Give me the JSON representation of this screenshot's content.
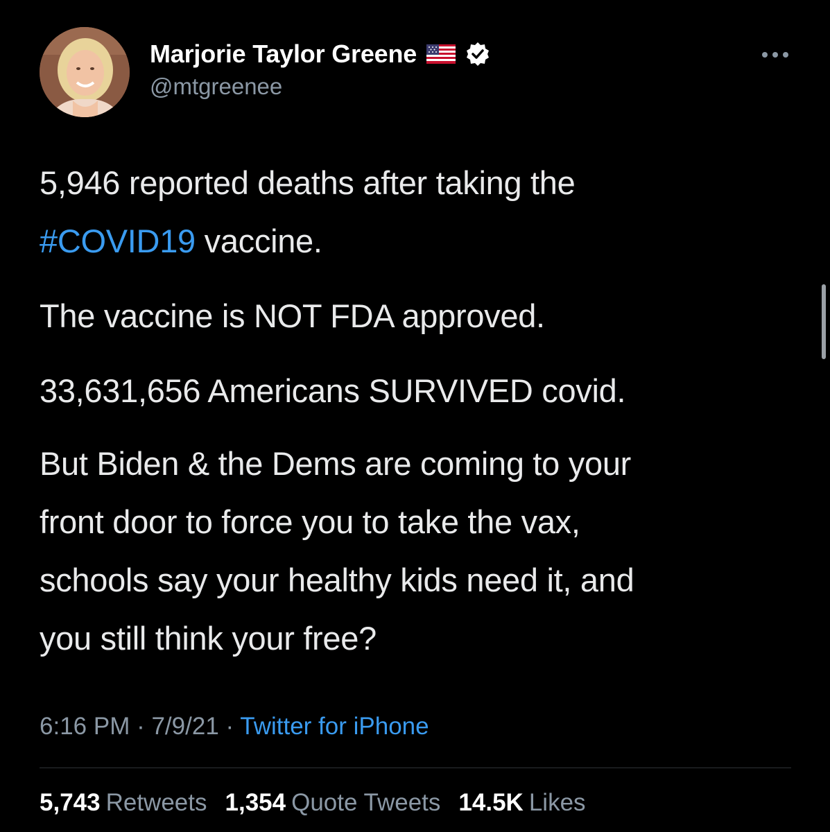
{
  "tweet": {
    "display_name": "Marjorie Taylor Greene",
    "handle": "@mtgreenee",
    "flag_icon": "us-flag-emoji",
    "verified_icon": "verified-badge",
    "more_icon": "ellipsis-horizontal",
    "paragraphs": {
      "p1_line1": "5,946 reported deaths after taking the",
      "p1_hashtag": "#COVID19",
      "p1_line2_rest": " vaccine.",
      "p2": "The vaccine is NOT FDA approved.",
      "p3": "33,631,656 Americans SURVIVED covid.",
      "p4_line1": "But Biden & the Dems are coming to your",
      "p4_line2": "front door to force you to take the vax,",
      "p4_line3": "schools say your healthy kids need it, and",
      "p4_line4": "you still think your free?"
    },
    "meta": {
      "time": "6:16 PM",
      "sep1": " · ",
      "date": "7/9/21",
      "sep2": " · ",
      "source": "Twitter for iPhone"
    },
    "stats": {
      "retweets_count": "5,743",
      "retweets_label": "Retweets",
      "quotes_count": "1,354",
      "quotes_label": "Quote Tweets",
      "likes_count": "14.5K",
      "likes_label": "Likes"
    }
  },
  "colors": {
    "background": "#000000",
    "text": "#e7e9ea",
    "secondary": "#8b98a5",
    "link": "#3a9bf0"
  }
}
